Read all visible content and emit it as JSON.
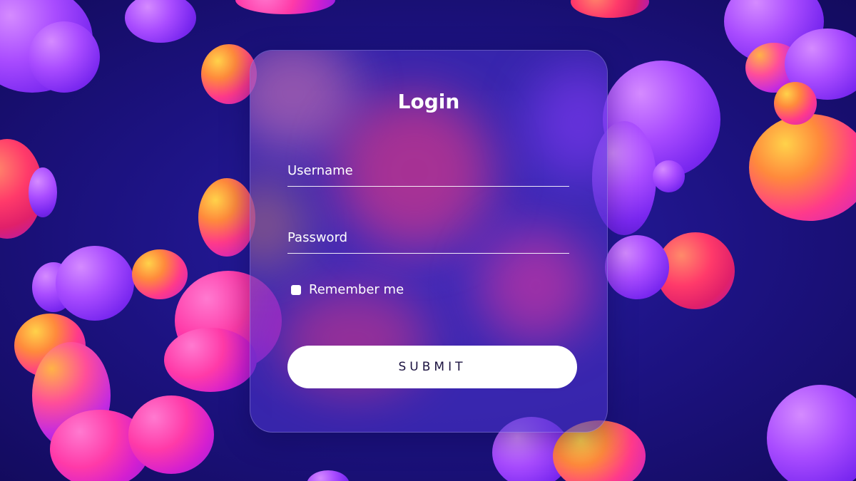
{
  "login_form": {
    "title": "Login",
    "username": {
      "placeholder": "Username",
      "value": ""
    },
    "password": {
      "placeholder": "Password",
      "value": ""
    },
    "remember_me": {
      "label": "Remember me",
      "checked": false
    },
    "submit_label": "SUBMIT"
  },
  "colors": {
    "background": "#1c1280",
    "card_tint": "#4832c8",
    "button": "#ffffff",
    "button_text": "#1b1240",
    "text": "#ffffff"
  }
}
